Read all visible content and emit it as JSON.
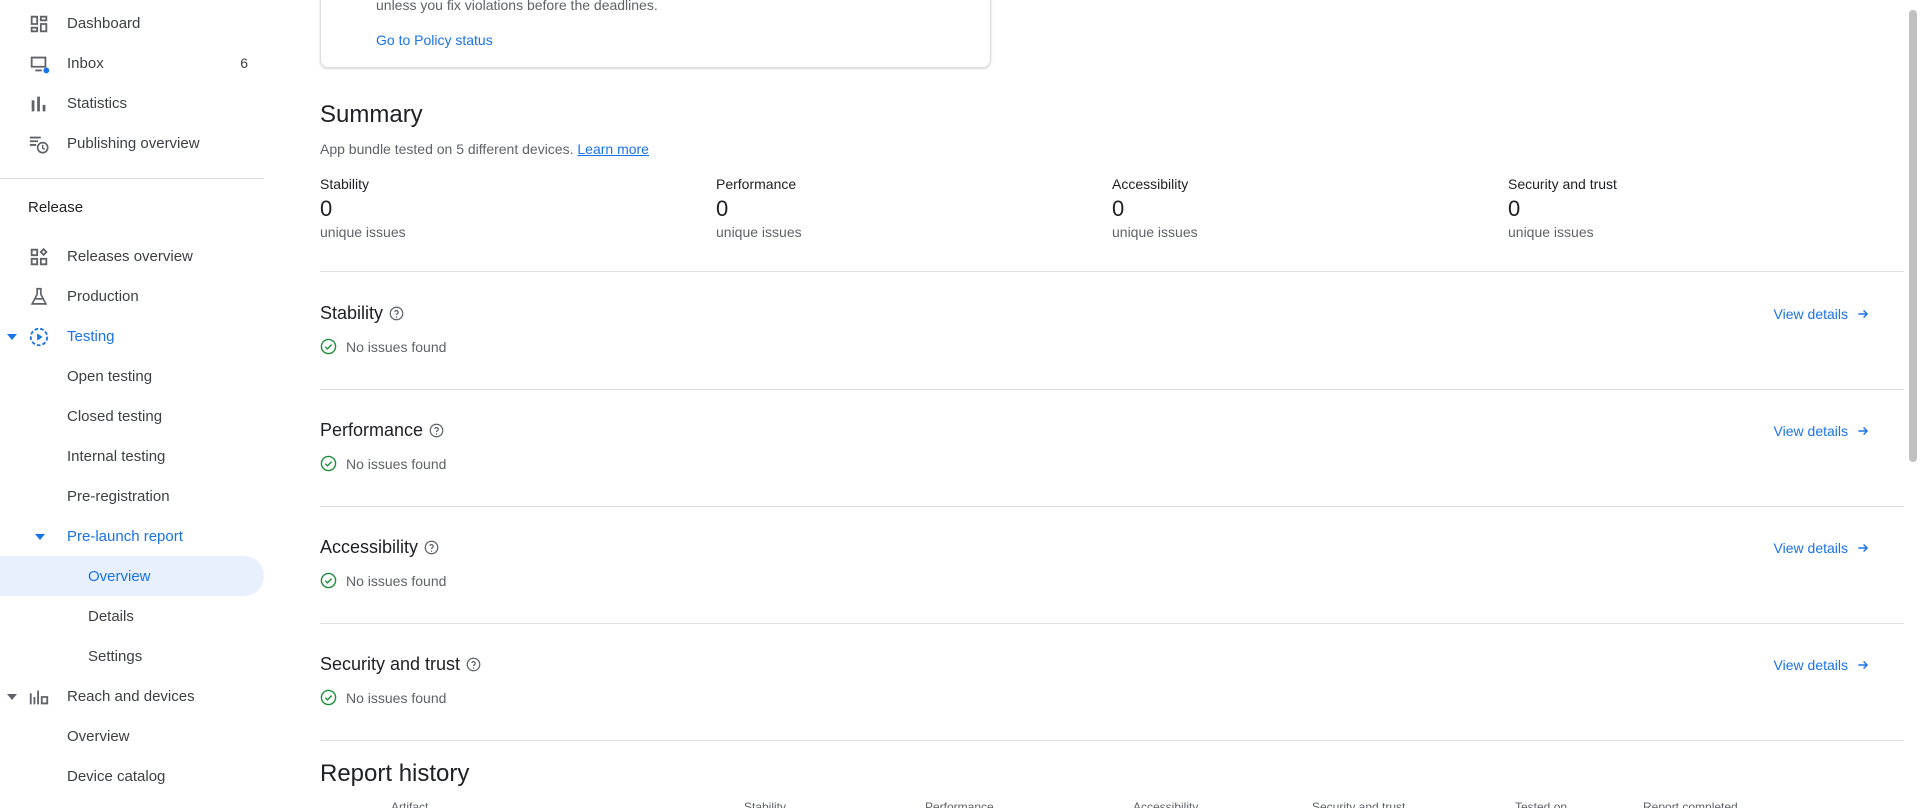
{
  "sidebar": {
    "top_items": [
      {
        "label": "Dashboard",
        "icon": "dashboard-icon"
      },
      {
        "label": "Inbox",
        "icon": "inbox-icon",
        "badge": "6"
      },
      {
        "label": "Statistics",
        "icon": "statistics-icon"
      },
      {
        "label": "Publishing overview",
        "icon": "publishing-icon"
      }
    ],
    "release_title": "Release",
    "release_items": [
      {
        "label": "Releases overview",
        "icon": "releases-overview-icon"
      },
      {
        "label": "Production",
        "icon": "production-icon"
      },
      {
        "label": "Testing",
        "icon": "testing-icon"
      }
    ],
    "testing_sub": [
      "Open testing",
      "Closed testing",
      "Internal testing",
      "Pre-registration"
    ],
    "prelaunch": {
      "label": "Pre-launch report",
      "sub": [
        "Overview",
        "Details",
        "Settings"
      ]
    },
    "reach": {
      "label": "Reach and devices",
      "sub": [
        "Overview",
        "Device catalog"
      ]
    }
  },
  "policy_card": {
    "cut_text": "unless you fix violations before the deadlines.",
    "link": "Go to Policy status"
  },
  "summary": {
    "title": "Summary",
    "subtitle": "App bundle tested on 5 different devices.",
    "learn_more": "Learn more",
    "metrics": [
      {
        "label": "Stability",
        "value": "0",
        "unit": "unique issues"
      },
      {
        "label": "Performance",
        "value": "0",
        "unit": "unique issues"
      },
      {
        "label": "Accessibility",
        "value": "0",
        "unit": "unique issues"
      },
      {
        "label": "Security and trust",
        "value": "0",
        "unit": "unique issues"
      }
    ]
  },
  "sections": [
    {
      "title": "Stability",
      "status": "No issues found",
      "action": "View details"
    },
    {
      "title": "Performance",
      "status": "No issues found",
      "action": "View details"
    },
    {
      "title": "Accessibility",
      "status": "No issues found",
      "action": "View details"
    },
    {
      "title": "Security and trust",
      "status": "No issues found",
      "action": "View details"
    }
  ],
  "history": {
    "title": "Report history",
    "columns": [
      "Artifact",
      "Stability",
      "Performance",
      "Accessibility",
      "Security and trust",
      "Tested on",
      "Report completed"
    ]
  },
  "colors": {
    "accent": "#1a73e8",
    "success": "#1e8e3e",
    "selected_bg": "#e8f0fe"
  }
}
